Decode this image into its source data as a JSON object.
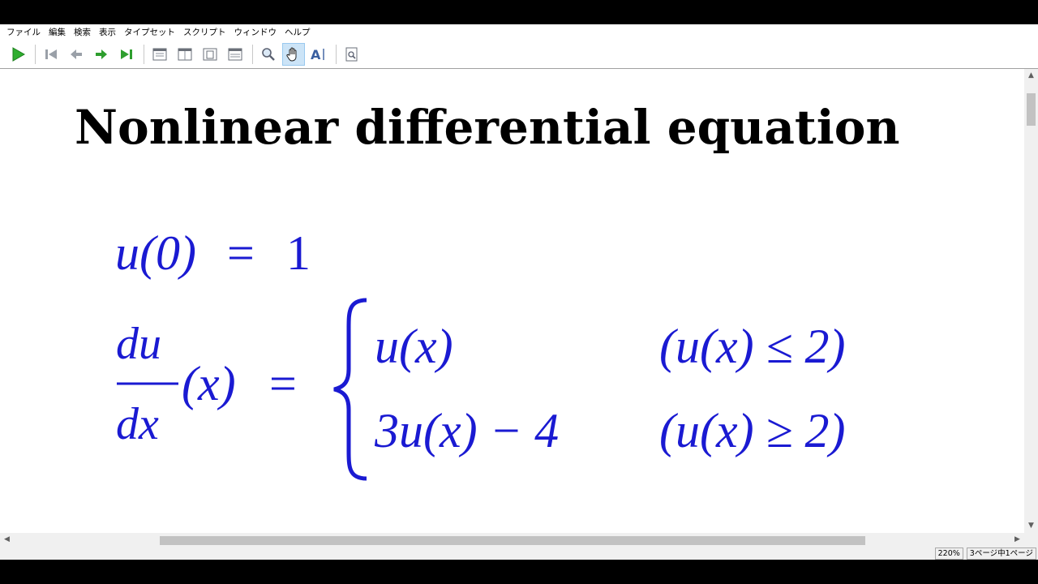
{
  "menu": {
    "items": [
      "ファイル",
      "編集",
      "検索",
      "表示",
      "タイプセット",
      "スクリプト",
      "ウィンドウ",
      "ヘルプ"
    ]
  },
  "toolbar": {
    "buttons": [
      {
        "icon": "play-typeset-icon"
      },
      {
        "icon": "first-page-icon"
      },
      {
        "icon": "previous-page-icon"
      },
      {
        "icon": "next-page-icon"
      },
      {
        "icon": "last-page-icon"
      },
      {
        "icon": "page-layout-single-icon"
      },
      {
        "icon": "page-layout-double-icon"
      },
      {
        "icon": "fit-page-icon"
      },
      {
        "icon": "fit-width-icon"
      },
      {
        "icon": "magnifier-icon"
      },
      {
        "icon": "hand-pan-icon",
        "active": true
      },
      {
        "icon": "text-select-icon"
      },
      {
        "icon": "page-search-icon"
      }
    ]
  },
  "document": {
    "title": "Nonlinear differential equation",
    "initial_condition": {
      "lhs": "u(0)",
      "eq": "=",
      "rhs": "1"
    },
    "ode": {
      "numerator": "du",
      "denominator": "dx",
      "arg": "(x)",
      "eq": "=",
      "cases": [
        {
          "expr": "u(x)",
          "cond": "(u(x) ≤ 2)"
        },
        {
          "expr": "3u(x) − 4",
          "cond": "(u(x) ≥ 2)"
        }
      ]
    },
    "math_color": "#1a1ad2"
  },
  "status": {
    "zoom": "220%",
    "page": "3ページ中1ページ"
  }
}
